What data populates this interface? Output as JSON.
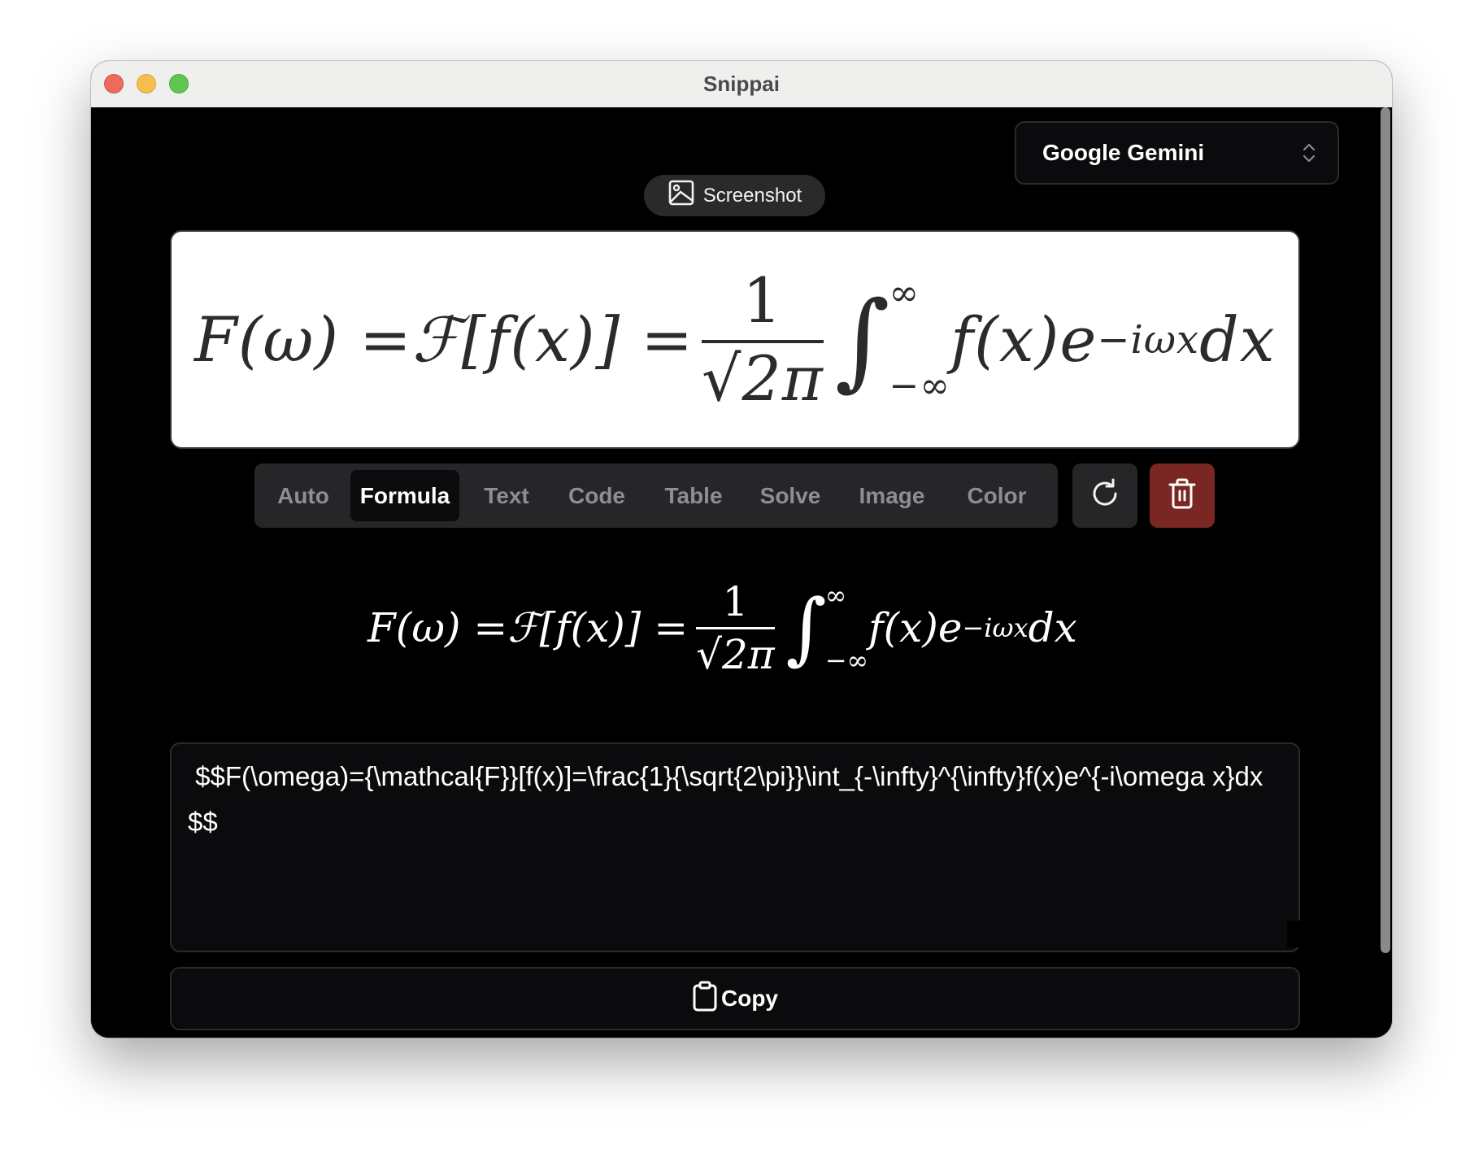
{
  "window": {
    "title": "Snippai"
  },
  "model_select": {
    "selected": "Google Gemini"
  },
  "screenshot_button": {
    "label": "Screenshot",
    "icon": "image-icon"
  },
  "captured_image": {
    "alt": "Captured formula screenshot",
    "parts": {
      "lhs": "F(ω) = ",
      "cal": "ℱ",
      "mid": "[f(x)] = ",
      "num": "1",
      "den_root": "√",
      "den": "2π",
      "int": "∫",
      "upper": "∞",
      "lower": "−∞",
      "body": "f(x)e",
      "exp": "−iωx",
      "tail": "dx"
    }
  },
  "tabs": [
    {
      "label": "Auto",
      "active": false
    },
    {
      "label": "Formula",
      "active": true
    },
    {
      "label": "Text",
      "active": false
    },
    {
      "label": "Code",
      "active": false
    },
    {
      "label": "Table",
      "active": false
    },
    {
      "label": "Solve",
      "active": false
    },
    {
      "label": "Image",
      "active": false
    },
    {
      "label": "Color",
      "active": false
    }
  ],
  "actions": {
    "refresh_icon": "refresh-icon",
    "delete_icon": "trash-icon"
  },
  "rendered_formula": {
    "lhs": "F(ω) = ",
    "cal": "ℱ",
    "mid": "[f(x)] = ",
    "num": "1",
    "den_root": "√",
    "den": "2π",
    "int": "∫",
    "upper": "∞",
    "lower": "−∞",
    "body": "f(x)e",
    "exp": "−iωx",
    "tail": "dx"
  },
  "latex_output": {
    "value": " $$F(\\omega)={\\mathcal{F}}[f(x)]=\\frac{1}{\\sqrt{2\\pi}}\\int_{-\\infty}^{\\infty}f(x)e^{-i\\omega x}dx$$"
  },
  "copy_button": {
    "label": "Copy",
    "icon": "clipboard-icon"
  },
  "colors": {
    "delete": "#7a2723",
    "active_tab": "#0b0b0d",
    "tab_bar": "#262628"
  }
}
